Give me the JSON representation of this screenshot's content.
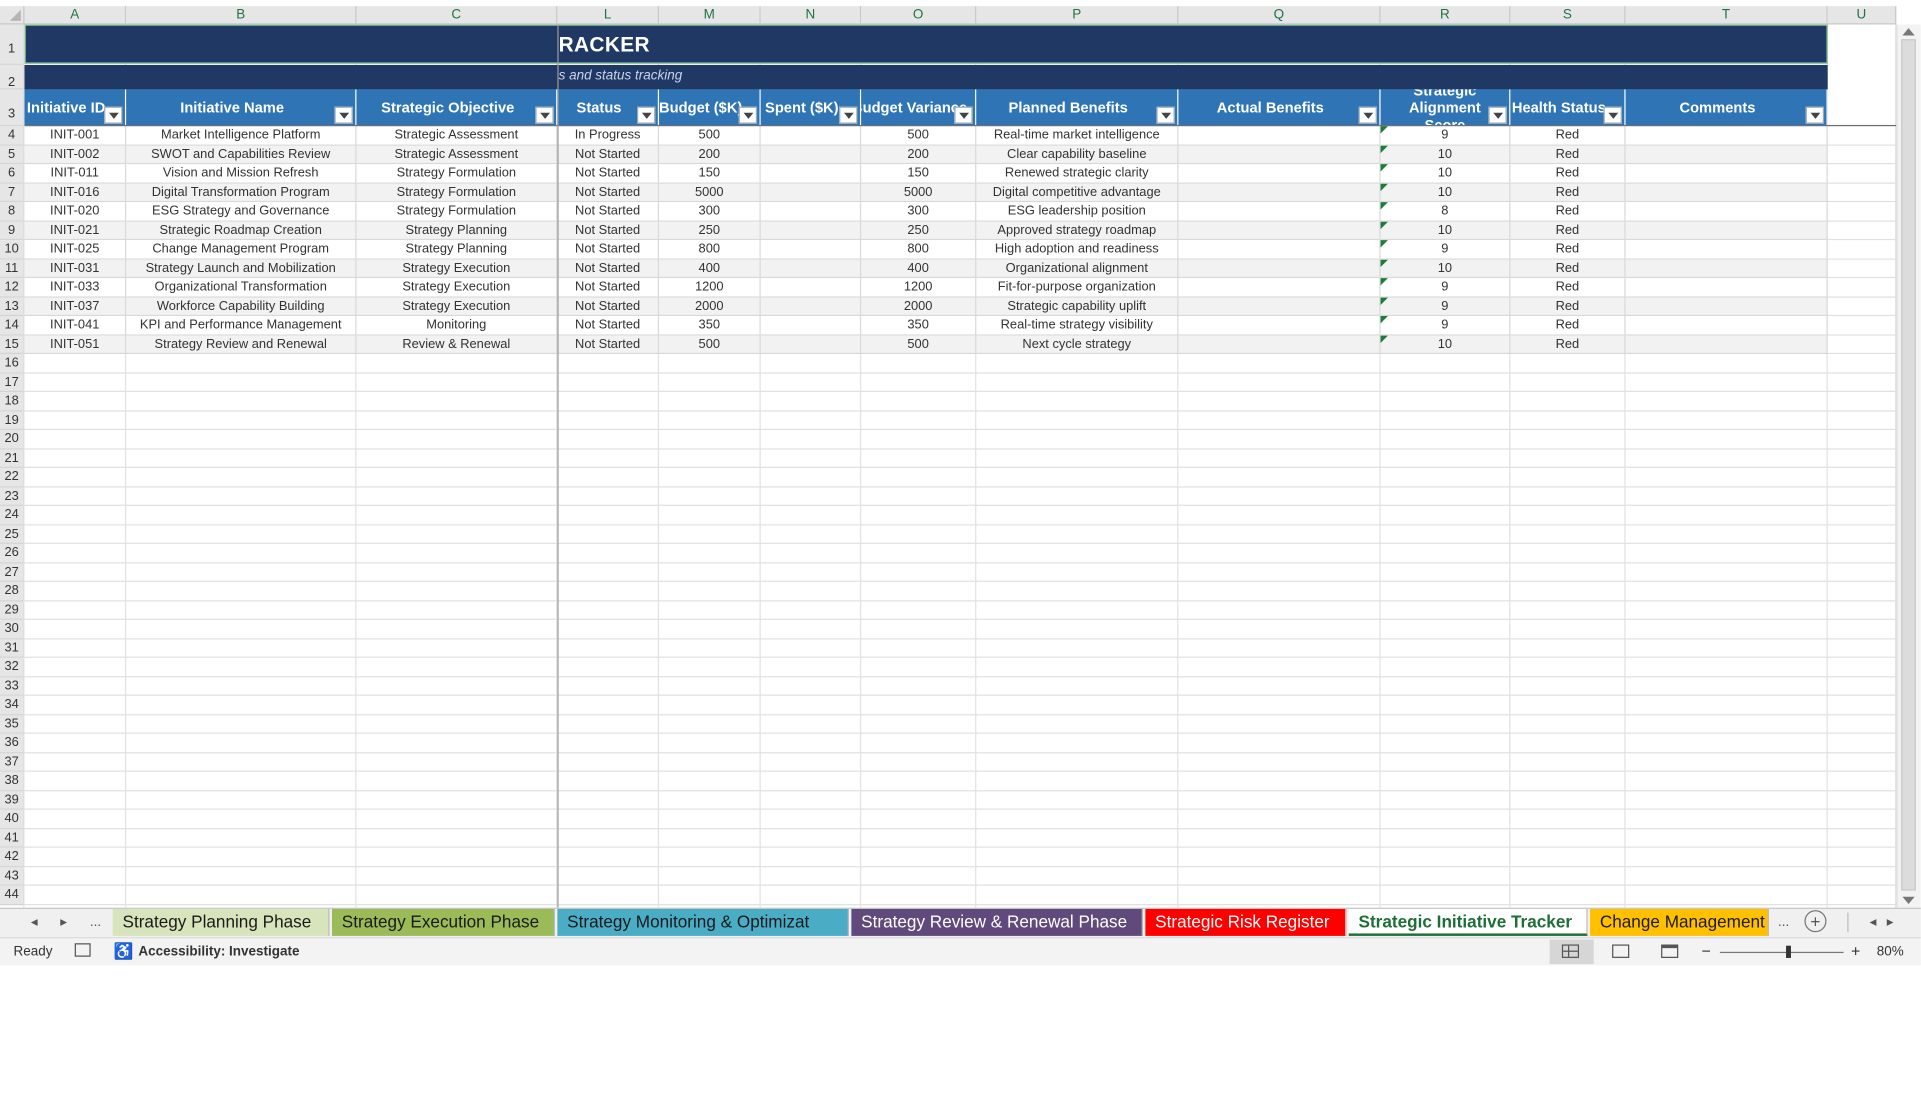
{
  "sheet": {
    "title": "RACKER",
    "subtitle": "s and status tracking",
    "column_letters": [
      "A",
      "B",
      "C",
      "L",
      "M",
      "N",
      "O",
      "P",
      "Q",
      "R",
      "S",
      "T",
      "U"
    ],
    "row_numbers": [
      "1",
      "2",
      "3",
      "4",
      "5",
      "6",
      "7",
      "8",
      "9",
      "10",
      "11",
      "12",
      "13",
      "14",
      "15",
      "16",
      "17",
      "18",
      "19",
      "20",
      "21",
      "22",
      "23",
      "24",
      "25",
      "26",
      "27",
      "28",
      "29",
      "30",
      "31",
      "32",
      "33",
      "34",
      "35",
      "36",
      "37",
      "38",
      "39",
      "40",
      "41",
      "42",
      "43",
      "44"
    ]
  },
  "table": {
    "headers": [
      "Initiative ID",
      "Initiative Name",
      "Strategic Objective",
      "Status",
      "Budget ($K)",
      "Spent ($K)",
      "Budget Variance",
      "Planned Benefits",
      "Actual Benefits",
      "Strategic Alignment Score",
      "Health Status",
      "Comments"
    ],
    "rows": [
      [
        "INIT-001",
        "Market Intelligence Platform",
        "Strategic Assessment",
        "In Progress",
        "500",
        "",
        "500",
        "Real-time market intelligence",
        "",
        "9",
        "Red",
        ""
      ],
      [
        "INIT-002",
        "SWOT and Capabilities Review",
        "Strategic Assessment",
        "Not Started",
        "200",
        "",
        "200",
        "Clear capability baseline",
        "",
        "10",
        "Red",
        ""
      ],
      [
        "INIT-011",
        "Vision and Mission Refresh",
        "Strategy Formulation",
        "Not Started",
        "150",
        "",
        "150",
        "Renewed strategic clarity",
        "",
        "10",
        "Red",
        ""
      ],
      [
        "INIT-016",
        "Digital Transformation Program",
        "Strategy Formulation",
        "Not Started",
        "5000",
        "",
        "5000",
        "Digital competitive advantage",
        "",
        "10",
        "Red",
        ""
      ],
      [
        "INIT-020",
        "ESG Strategy and Governance",
        "Strategy Formulation",
        "Not Started",
        "300",
        "",
        "300",
        "ESG leadership position",
        "",
        "8",
        "Red",
        ""
      ],
      [
        "INIT-021",
        "Strategic Roadmap Creation",
        "Strategy Planning",
        "Not Started",
        "250",
        "",
        "250",
        "Approved strategy roadmap",
        "",
        "10",
        "Red",
        ""
      ],
      [
        "INIT-025",
        "Change Management Program",
        "Strategy Planning",
        "Not Started",
        "800",
        "",
        "800",
        "High adoption and readiness",
        "",
        "9",
        "Red",
        ""
      ],
      [
        "INIT-031",
        "Strategy Launch and Mobilization",
        "Strategy Execution",
        "Not Started",
        "400",
        "",
        "400",
        "Organizational alignment",
        "",
        "10",
        "Red",
        ""
      ],
      [
        "INIT-033",
        "Organizational Transformation",
        "Strategy Execution",
        "Not Started",
        "1200",
        "",
        "1200",
        "Fit-for-purpose organization",
        "",
        "9",
        "Red",
        ""
      ],
      [
        "INIT-037",
        "Workforce Capability Building",
        "Strategy Execution",
        "Not Started",
        "2000",
        "",
        "2000",
        "Strategic capability uplift",
        "",
        "9",
        "Red",
        ""
      ],
      [
        "INIT-041",
        "KPI and Performance Management",
        "Monitoring",
        "Not Started",
        "350",
        "",
        "350",
        "Real-time strategy visibility",
        "",
        "9",
        "Red",
        ""
      ],
      [
        "INIT-051",
        "Strategy Review and Renewal",
        "Review & Renewal",
        "Not Started",
        "500",
        "",
        "500",
        "Next cycle strategy",
        "",
        "10",
        "Red",
        ""
      ]
    ]
  },
  "tabs": [
    {
      "label": "Strategy Planning Phase",
      "bg": "#d8e4bc",
      "color": "#1a1a1a"
    },
    {
      "label": "Strategy Execution Phase",
      "bg": "#9bbb59",
      "color": "#1a1a1a"
    },
    {
      "label": "Strategy Monitoring & Optimizat",
      "bg": "#4bacc6",
      "color": "#1a1a1a"
    },
    {
      "label": "Strategy Review & Renewal Phase",
      "bg": "#604a7b",
      "color": "#ffffff"
    },
    {
      "label": "Strategic Risk Register",
      "bg": "#ff0000",
      "color": "#ffffff"
    },
    {
      "label": "Strategic Initiative Tracker",
      "bg": "#ffffff",
      "color": "#1e6e38",
      "active": true
    },
    {
      "label": "Change Management",
      "bg": "#ffc000",
      "color": "#1a1a1a"
    }
  ],
  "tabnav": {
    "prev": "◂",
    "next": "▸",
    "more": "...",
    "more_right": "...",
    "add": "+"
  },
  "status": {
    "ready": "Ready",
    "accessibility": "Accessibility: Investigate",
    "zoom_minus": "−",
    "zoom_plus": "+",
    "zoom": "80%",
    "zoom_level": 0.55
  },
  "colors": {
    "title_band": "#1f3864",
    "header_fill": "#2f75b5",
    "active_tab": "#1e6e38"
  }
}
